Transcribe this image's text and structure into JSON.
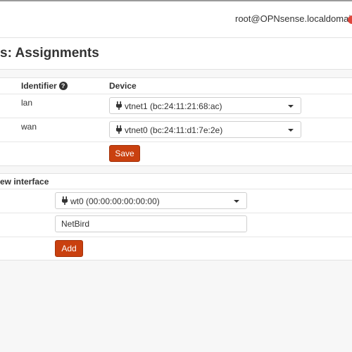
{
  "header": {
    "user": "root@OPNsense.localdomain",
    "status_color": "#e0463c"
  },
  "page": {
    "title": "s: Assignments"
  },
  "assignments": {
    "columns": {
      "identifier": "Identifier",
      "help_icon": "?",
      "device": "Device"
    },
    "rows": [
      {
        "identifier": "lan",
        "device": "vtnet1 (bc:24:11:21:68:ac)"
      },
      {
        "identifier": "wan",
        "device": "vtnet0 (bc:24:11:d1:7e:2e)"
      }
    ],
    "save_label": "Save"
  },
  "new_interface": {
    "title": "ew interface",
    "device": "wt0 (00:00:00:00:00:00)",
    "description_value": "NetBird",
    "add_label": "Add"
  },
  "colors": {
    "accent_button": "#c9400f",
    "status_dot": "#e0463c"
  }
}
